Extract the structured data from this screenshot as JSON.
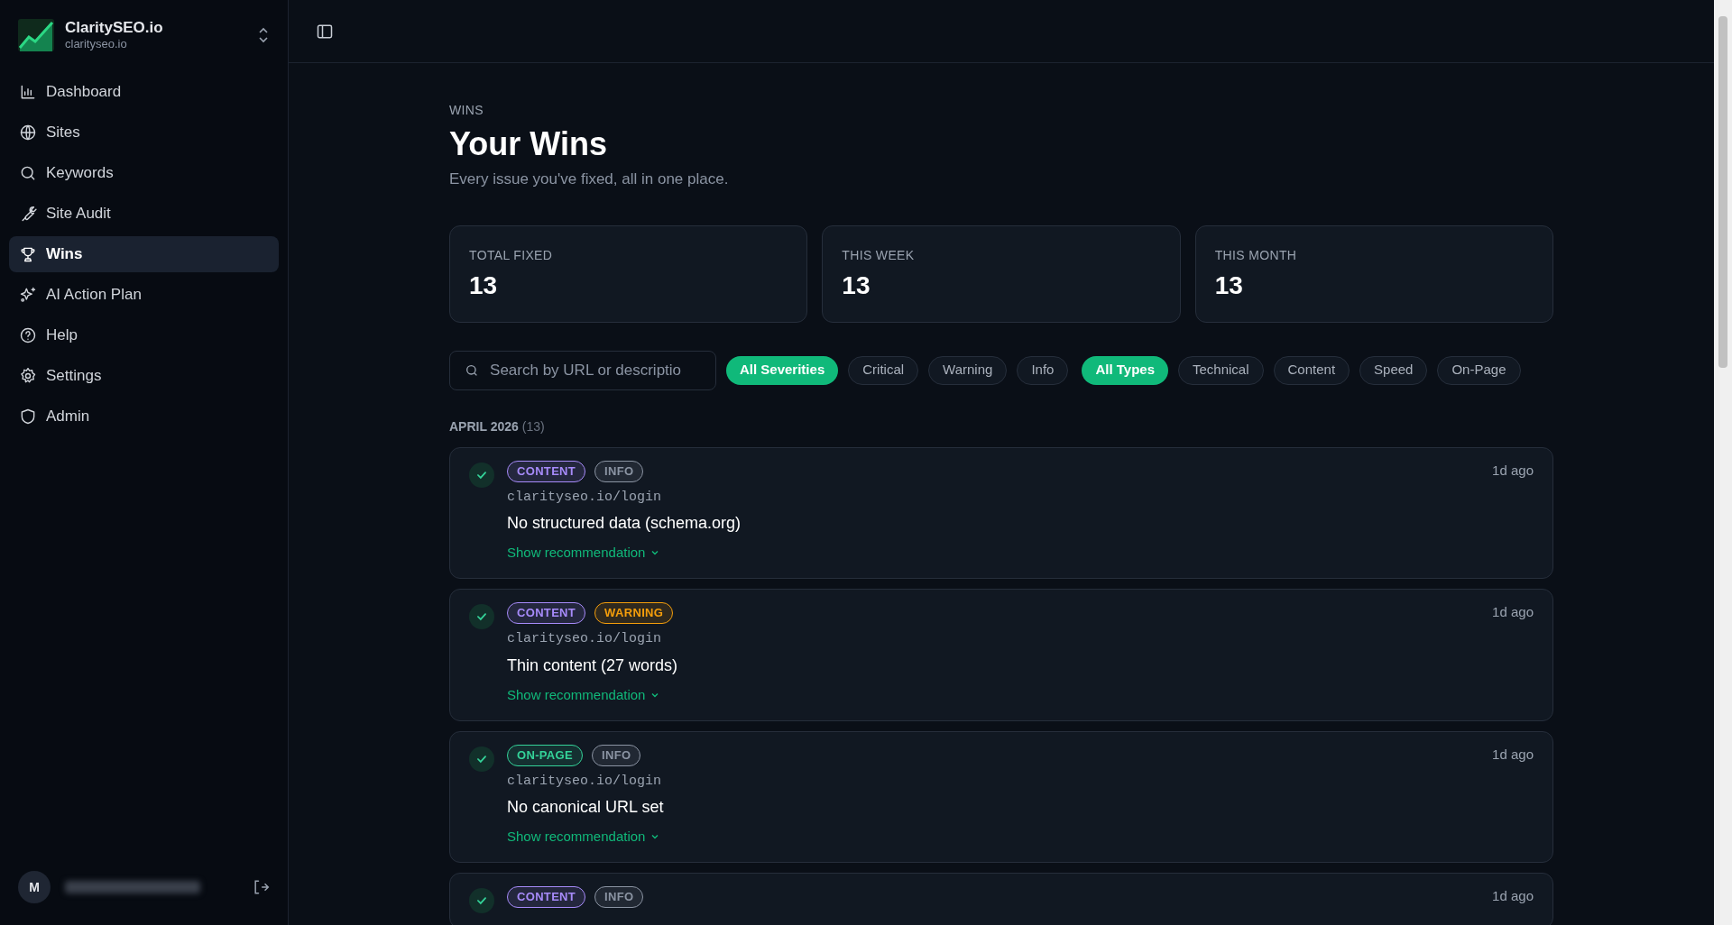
{
  "sidebar": {
    "brand": {
      "name": "ClaritySEO.io",
      "domain": "clarityseo.io"
    },
    "items": [
      {
        "label": "Dashboard",
        "selected": false
      },
      {
        "label": "Sites",
        "selected": false
      },
      {
        "label": "Keywords",
        "selected": false
      },
      {
        "label": "Site Audit",
        "selected": false
      },
      {
        "label": "Wins",
        "selected": true
      },
      {
        "label": "AI Action Plan",
        "selected": false
      },
      {
        "label": "Help",
        "selected": false
      },
      {
        "label": "Settings",
        "selected": false
      },
      {
        "label": "Admin",
        "selected": false
      }
    ],
    "user": {
      "initial": "M"
    }
  },
  "page": {
    "eyebrow": "WINS",
    "title": "Your Wins",
    "subtitle": "Every issue you've fixed, all in one place."
  },
  "stats": [
    {
      "label": "TOTAL FIXED",
      "value": "13"
    },
    {
      "label": "THIS WEEK",
      "value": "13"
    },
    {
      "label": "THIS MONTH",
      "value": "13"
    }
  ],
  "search": {
    "placeholder": "Search by URL or descriptio"
  },
  "filter_groups": [
    [
      {
        "label": "All Severities",
        "selected": true
      },
      {
        "label": "Critical",
        "selected": false
      },
      {
        "label": "Warning",
        "selected": false
      },
      {
        "label": "Info",
        "selected": false
      }
    ],
    [
      {
        "label": "All Types",
        "selected": true
      },
      {
        "label": "Technical",
        "selected": false
      },
      {
        "label": "Content",
        "selected": false
      },
      {
        "label": "Speed",
        "selected": false
      },
      {
        "label": "On-Page",
        "selected": false
      }
    ]
  ],
  "group": {
    "label": "APRIL 2026",
    "count": "(13)"
  },
  "wins": [
    {
      "tags": [
        {
          "label": "CONTENT",
          "color": "#a78bfa"
        },
        {
          "label": "INFO",
          "color": "#8b94a3"
        }
      ],
      "url": "clarityseo.io/login",
      "title": "No structured data (schema.org)",
      "link": "Show recommendation",
      "time": "1d ago"
    },
    {
      "tags": [
        {
          "label": "CONTENT",
          "color": "#a78bfa"
        },
        {
          "label": "WARNING",
          "color": "#f59e0b"
        }
      ],
      "url": "clarityseo.io/login",
      "title": "Thin content (27 words)",
      "link": "Show recommendation",
      "time": "1d ago"
    },
    {
      "tags": [
        {
          "label": "ON-PAGE",
          "color": "#34d399"
        },
        {
          "label": "INFO",
          "color": "#8b94a3"
        }
      ],
      "url": "clarityseo.io/login",
      "title": "No canonical URL set",
      "link": "Show recommendation",
      "time": "1d ago"
    },
    {
      "tags": [
        {
          "label": "CONTENT",
          "color": "#a78bfa"
        },
        {
          "label": "INFO",
          "color": "#8b94a3"
        }
      ],
      "time": "1d ago"
    }
  ]
}
